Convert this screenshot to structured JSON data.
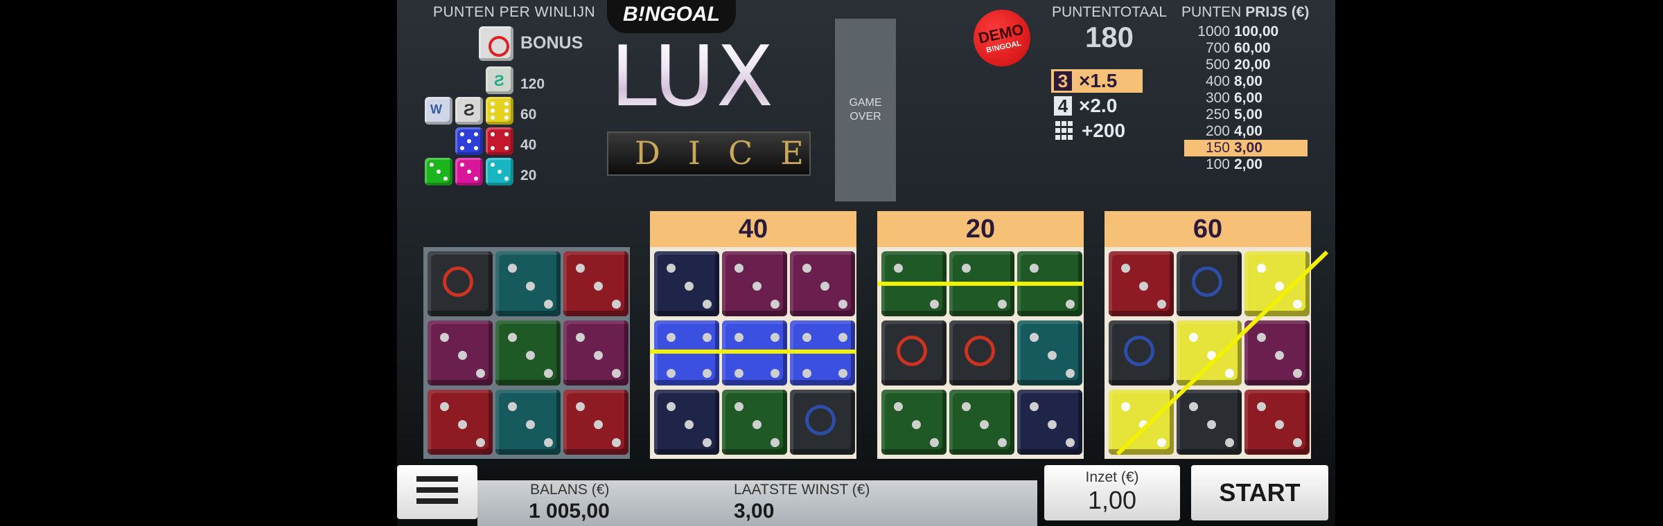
{
  "brand": "B!NGOAL",
  "logo": {
    "title": "LUX",
    "subtitle": "DICE"
  },
  "game_over": "GAME OVER",
  "demo_badge": {
    "text": "DEMO",
    "sub": "B!NGOAL"
  },
  "points_per_winline": {
    "title": "PUNTEN PER WINLIJN",
    "rows": [
      {
        "label": "BONUS"
      },
      {
        "label": "120"
      },
      {
        "label": "60"
      },
      {
        "label": "40"
      },
      {
        "label": "20"
      }
    ]
  },
  "total": {
    "label": "PUNTENTOTAAL",
    "value": "180"
  },
  "multipliers": [
    {
      "badge": "3",
      "value": "×1.5",
      "highlighted": true
    },
    {
      "badge": "4",
      "value": "×2.0",
      "highlighted": false
    },
    {
      "badge": "grid",
      "value": "+200",
      "highlighted": false
    }
  ],
  "prize_table": {
    "title_a": "PUNTEN",
    "title_b": "PRIJS (€)",
    "rows": [
      {
        "points": "1000",
        "prize": "100,00",
        "highlighted": false
      },
      {
        "points": "700",
        "prize": "60,00",
        "highlighted": false
      },
      {
        "points": "500",
        "prize": "20,00",
        "highlighted": false
      },
      {
        "points": "400",
        "prize": "8,00",
        "highlighted": false
      },
      {
        "points": "300",
        "prize": "6,00",
        "highlighted": false
      },
      {
        "points": "250",
        "prize": "5,00",
        "highlighted": false
      },
      {
        "points": "200",
        "prize": "4,00",
        "highlighted": false
      },
      {
        "points": "150",
        "prize": "3,00",
        "highlighted": true
      },
      {
        "points": "100",
        "prize": "2,00",
        "highlighted": false
      }
    ]
  },
  "grids": [
    {
      "score": "",
      "cells": [
        "black-bonus",
        "teal-3",
        "red-3",
        "purple-3",
        "green-3",
        "purple-3",
        "red-3",
        "teal-3",
        "red-3"
      ]
    },
    {
      "score": "40",
      "cells": [
        "navy-3",
        "purple-3",
        "purple-3",
        "blue-4",
        "blue-4",
        "blue-4",
        "navy-3",
        "green-3",
        "black-logo"
      ]
    },
    {
      "score": "20",
      "cells": [
        "green-2",
        "green-2",
        "green-2",
        "black-bonus",
        "black-bonus",
        "teal-3",
        "green-3",
        "green-3",
        "navy-3"
      ]
    },
    {
      "score": "60",
      "cells": [
        "red-3",
        "black-logo",
        "yellow-3",
        "black-logo",
        "yellow-3",
        "purple-3",
        "yellow-3",
        "black-3",
        "red-3"
      ]
    }
  ],
  "colors": {
    "accent": "#f6c177",
    "winline": "#f2f200"
  },
  "bottom": {
    "balance_label": "BALANS (€)",
    "balance_value": "1 005,00",
    "last_win_label": "LAATSTE WINST (€)",
    "last_win_value": "3,00",
    "stake_label": "Inzet (€)",
    "stake_value": "1,00",
    "start_label": "START",
    "menu_icon": "hamburger-menu-icon"
  }
}
